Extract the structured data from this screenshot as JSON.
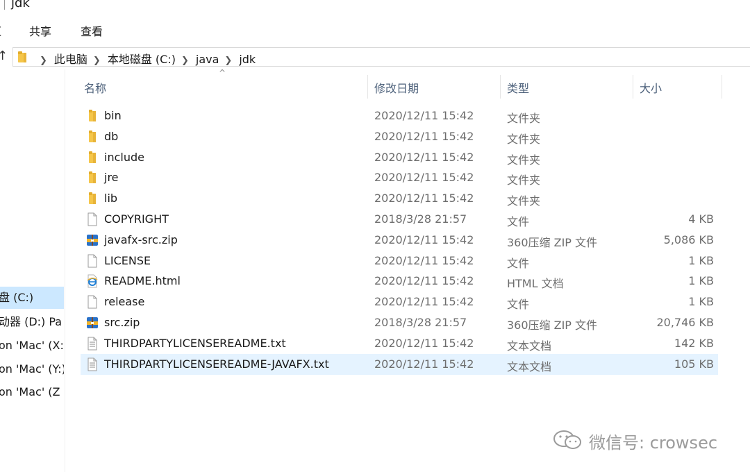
{
  "window": {
    "title": "jdk"
  },
  "ribbon": {
    "share_label": "共享",
    "view_label": "查看"
  },
  "address": {
    "crumbs": [
      "此电脑",
      "本地磁盘 (C:)",
      "java",
      "jdk"
    ]
  },
  "nav": {
    "items": [
      {
        "label": "盘 (C:)",
        "selected": true
      },
      {
        "label": "动器 (D:) Pa",
        "selected": false
      },
      {
        "label": "on 'Mac' (X:",
        "selected": false
      },
      {
        "label": "on 'Mac' (Y:)",
        "selected": false
      },
      {
        "label": "on 'Mac' (Z",
        "selected": false
      }
    ]
  },
  "columns": {
    "name": "名称",
    "date": "修改日期",
    "type": "类型",
    "size": "大小"
  },
  "files": [
    {
      "name": "bin",
      "date": "2020/12/11 15:42",
      "type": "文件夹",
      "size": "",
      "icon": "folder-icon"
    },
    {
      "name": "db",
      "date": "2020/12/11 15:42",
      "type": "文件夹",
      "size": "",
      "icon": "folder-icon"
    },
    {
      "name": "include",
      "date": "2020/12/11 15:42",
      "type": "文件夹",
      "size": "",
      "icon": "folder-icon"
    },
    {
      "name": "jre",
      "date": "2020/12/11 15:42",
      "type": "文件夹",
      "size": "",
      "icon": "folder-icon"
    },
    {
      "name": "lib",
      "date": "2020/12/11 15:42",
      "type": "文件夹",
      "size": "",
      "icon": "folder-icon"
    },
    {
      "name": "COPYRIGHT",
      "date": "2018/3/28 21:57",
      "type": "文件",
      "size": "4 KB",
      "icon": "file-icon"
    },
    {
      "name": "javafx-src.zip",
      "date": "2020/12/11 15:42",
      "type": "360压缩 ZIP 文件",
      "size": "5,086 KB",
      "icon": "zip-icon"
    },
    {
      "name": "LICENSE",
      "date": "2020/12/11 15:42",
      "type": "文件",
      "size": "1 KB",
      "icon": "file-icon"
    },
    {
      "name": "README.html",
      "date": "2020/12/11 15:42",
      "type": "HTML 文档",
      "size": "1 KB",
      "icon": "ie-html-icon"
    },
    {
      "name": "release",
      "date": "2020/12/11 15:42",
      "type": "文件",
      "size": "1 KB",
      "icon": "file-icon"
    },
    {
      "name": "src.zip",
      "date": "2018/3/28 21:57",
      "type": "360压缩 ZIP 文件",
      "size": "20,746 KB",
      "icon": "zip-icon"
    },
    {
      "name": "THIRDPARTYLICENSEREADME.txt",
      "date": "2020/12/11 15:42",
      "type": "文本文档",
      "size": "142 KB",
      "icon": "text-file-icon"
    },
    {
      "name": "THIRDPARTYLICENSEREADME-JAVAFX.txt",
      "date": "2020/12/11 15:42",
      "type": "文本文档",
      "size": "105 KB",
      "icon": "text-file-icon",
      "selected": true
    }
  ],
  "watermark": {
    "text": "微信号: crowsec"
  },
  "colors": {
    "folder": "#f5c64a",
    "selection": "#cce8ff",
    "hover_row": "#e5f3ff",
    "header_text": "#4c607a"
  }
}
